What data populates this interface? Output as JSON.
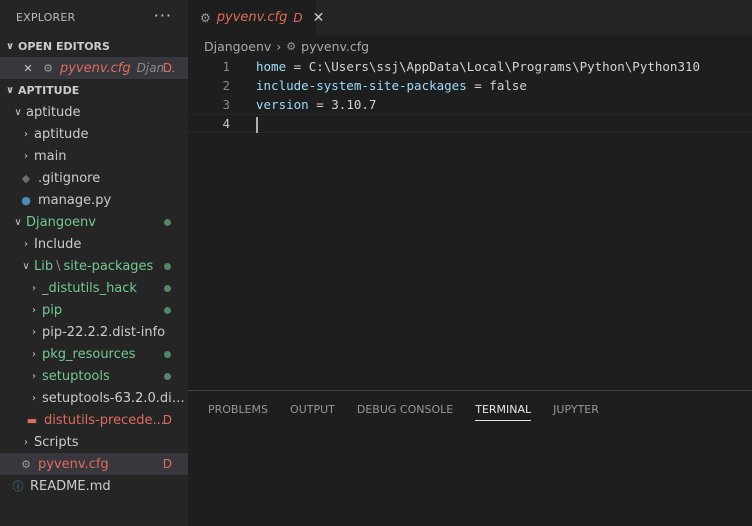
{
  "sidebar": {
    "title": "EXPLORER",
    "more": "···",
    "open_editors": {
      "header": "OPEN EDITORS",
      "items": [
        {
          "close": "✕",
          "name": "pyvenv.cfg",
          "path": "Djan...",
          "badge": "D"
        }
      ]
    },
    "workspace": {
      "header": "APTITUDE",
      "tree": [
        {
          "label": "aptitude",
          "chevron": "∨"
        },
        {
          "label": "aptitude",
          "chevron": "›"
        },
        {
          "label": "main",
          "chevron": "›"
        },
        {
          "label": ".gitignore"
        },
        {
          "label": "manage.py"
        },
        {
          "label": "Djangoenv",
          "chevron": "∨"
        },
        {
          "label": "Include",
          "chevron": "›"
        },
        {
          "label": "Lib",
          "sep": "\\",
          "label2": "site-packages",
          "chevron": "∨"
        },
        {
          "label": "_distutils_hack",
          "chevron": "›"
        },
        {
          "label": "pip",
          "chevron": "›"
        },
        {
          "label": "pip-22.2.2.dist-info",
          "chevron": "›"
        },
        {
          "label": "pkg_resources",
          "chevron": "›"
        },
        {
          "label": "setuptools",
          "chevron": "›"
        },
        {
          "label": "setuptools-63.2.0.dist-i...",
          "chevron": "›"
        },
        {
          "label": "distutils-precede...",
          "badge": "D"
        },
        {
          "label": "Scripts",
          "chevron": "›"
        },
        {
          "label": "pyvenv.cfg",
          "badge": "D"
        },
        {
          "label": "README.md"
        }
      ]
    }
  },
  "editor": {
    "tab": {
      "name": "pyvenv.cfg",
      "badge": "D",
      "close": "✕"
    },
    "breadcrumbs": {
      "folder": "Djangoenv",
      "sep": "›",
      "file": "pyvenv.cfg"
    },
    "lines": [
      {
        "num": "1",
        "key": "home",
        "op": " = ",
        "val": "C:\\Users\\ssj\\AppData\\Local\\Programs\\Python\\Python310"
      },
      {
        "num": "2",
        "key": "include-system-site-packages",
        "op": " = ",
        "val": "false"
      },
      {
        "num": "3",
        "key": "version",
        "op": " = ",
        "val": "3.10.7"
      },
      {
        "num": "4",
        "key": "",
        "op": "",
        "val": ""
      }
    ]
  },
  "panel": {
    "tabs": [
      "PROBLEMS",
      "OUTPUT",
      "DEBUG CONSOLE",
      "TERMINAL",
      "JUPYTER"
    ],
    "active": "TERMINAL"
  },
  "colors": {
    "untracked": "#73c991",
    "deleted": "#e06c5c",
    "key": "#9cdcfe"
  }
}
